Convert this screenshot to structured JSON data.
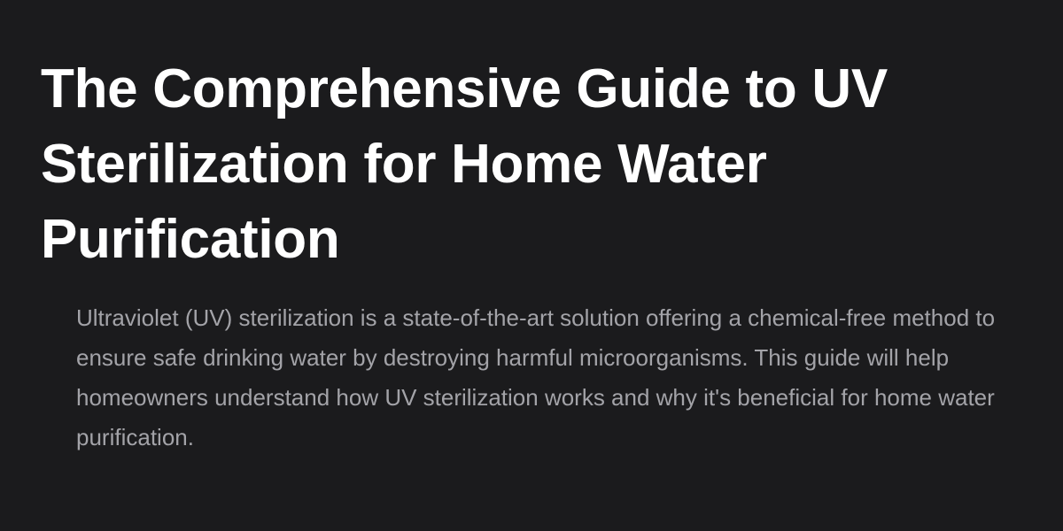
{
  "article": {
    "title": "The Comprehensive Guide to UV Sterilization for Home Water Purification",
    "intro": "Ultraviolet (UV) sterilization is a state-of-the-art solution offering a chemical-free method to ensure safe drinking water by destroying harmful microorganisms. This guide will help homeowners understand how UV sterilization works and why it's beneficial for home water purification."
  },
  "colors": {
    "background": "#1b1b1d",
    "title": "#ffffff",
    "body_text": "#a3a3a8"
  }
}
